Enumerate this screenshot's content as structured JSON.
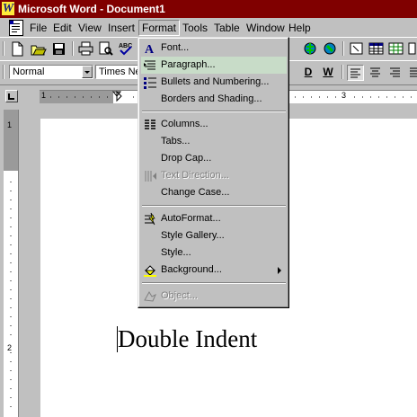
{
  "window": {
    "title": "Microsoft Word - Document1",
    "logo_letter": "W"
  },
  "menubar": {
    "items": [
      "File",
      "Edit",
      "View",
      "Insert",
      "Format",
      "Tools",
      "Table",
      "Window",
      "Help"
    ],
    "active": "Format"
  },
  "formatting_toolbar": {
    "style_value": "Normal",
    "font_value": "Times New Roman",
    "bold_label": "D",
    "underline_label": "W"
  },
  "ruler": {
    "tick_labels": [
      "1",
      "3"
    ]
  },
  "vertical_ruler": {
    "tick_labels": [
      "1",
      "2"
    ]
  },
  "format_menu": {
    "items": [
      {
        "label": "Font...",
        "enabled": true
      },
      {
        "label": "Paragraph...",
        "enabled": true,
        "highlighted": true
      },
      {
        "label": "Bullets and Numbering...",
        "enabled": true
      },
      {
        "label": "Borders and Shading...",
        "enabled": true
      },
      {
        "label": "Columns...",
        "enabled": true
      },
      {
        "label": "Tabs...",
        "enabled": true
      },
      {
        "label": "Drop Cap...",
        "enabled": true
      },
      {
        "label": "Text Direction...",
        "enabled": false
      },
      {
        "label": "Change Case...",
        "enabled": true
      },
      {
        "label": "AutoFormat...",
        "enabled": true
      },
      {
        "label": "Style Gallery...",
        "enabled": true
      },
      {
        "label": "Style...",
        "enabled": true
      },
      {
        "label": "Background...",
        "enabled": true,
        "submenu": true
      },
      {
        "label": "Object...",
        "enabled": false
      }
    ]
  },
  "document": {
    "text": "Double Indent"
  },
  "colors": {
    "titlebar": "#800000",
    "face": "#c0c0c0",
    "highlight": "#c8dcc8"
  }
}
